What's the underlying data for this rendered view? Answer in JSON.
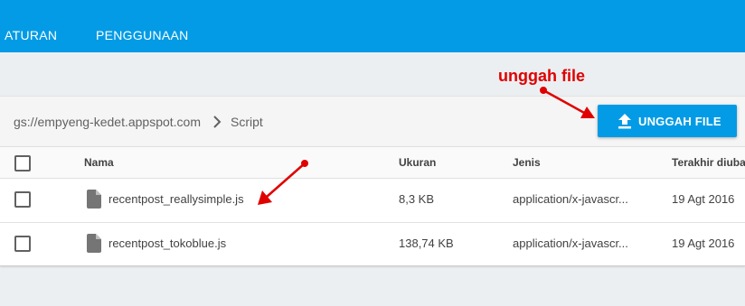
{
  "tabs": [
    "ATURAN",
    "PENGGUNAAN"
  ],
  "annotation": "unggah file",
  "breadcrumb": {
    "bucket": "gs://empyeng-kedet.appspot.com",
    "folder": "Script"
  },
  "upload_button": "UNGGAH FILE",
  "table": {
    "headers": {
      "name": "Nama",
      "size": "Ukuran",
      "type": "Jenis",
      "modified": "Terakhir diubah"
    },
    "rows": [
      {
        "name": "recentpost_reallysimple.js",
        "size": "8,3 KB",
        "type": "application/x-javascr...",
        "modified": "19 Agt 2016"
      },
      {
        "name": "recentpost_tokoblue.js",
        "size": "138,74 KB",
        "type": "application/x-javascr...",
        "modified": "19 Agt 2016"
      }
    ]
  },
  "colors": {
    "accent": "#039be5",
    "annotation": "#e00000"
  }
}
